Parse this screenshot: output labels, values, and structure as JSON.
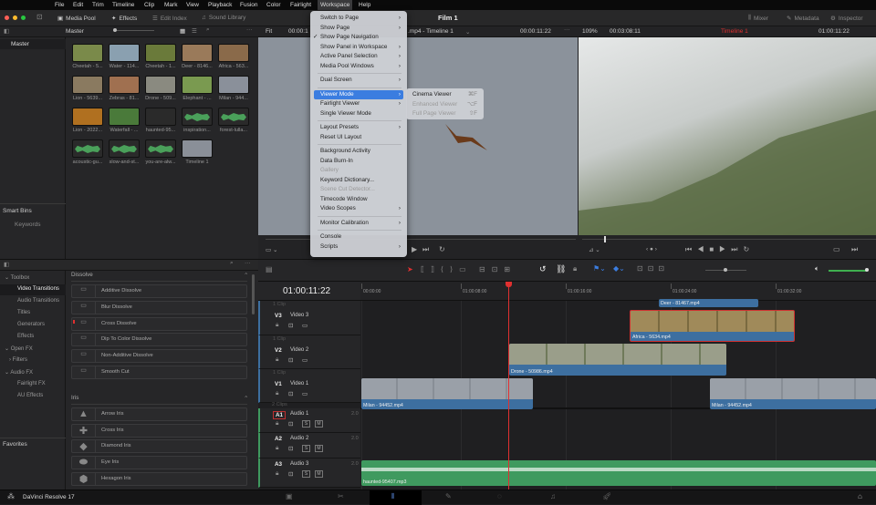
{
  "menubar": {
    "items": [
      "File",
      "Edit",
      "Trim",
      "Timeline",
      "Clip",
      "Mark",
      "View",
      "Playback",
      "Fusion",
      "Color",
      "Fairlight",
      "Workspace",
      "Help"
    ],
    "active": "Workspace"
  },
  "toolbar": {
    "media_pool": "Media Pool",
    "effects": "Effects",
    "edit_index": "Edit Index",
    "sound_library": "Sound Library",
    "project_title": "Film 1",
    "mixer": "Mixer",
    "metadata": "Metadata",
    "inspector": "Inspector"
  },
  "media_pool": {
    "bin_title": "Master",
    "bins": [
      "Master"
    ],
    "smart_bins_label": "Smart Bins",
    "smart_bins": [
      "Keywords"
    ],
    "clips": [
      {
        "name": "Cheetah - 5...",
        "color": "#7a8a4a"
      },
      {
        "name": "Water - 114...",
        "color": "#8aa0b0"
      },
      {
        "name": "Cheetah - 1...",
        "color": "#6a7a3a"
      },
      {
        "name": "Deer - 8146...",
        "color": "#9a7a5a"
      },
      {
        "name": "Africa - 563...",
        "color": "#8a6a4a"
      },
      {
        "name": "Lion - 5639...",
        "color": "#8a7a60"
      },
      {
        "name": "Zebras - 81...",
        "color": "#a07050"
      },
      {
        "name": "Drone - 509...",
        "color": "#8a8a80"
      },
      {
        "name": "Elephant - ...",
        "color": "#7a9a50"
      },
      {
        "name": "Milan - 944...",
        "color": "#8a909a"
      },
      {
        "name": "Lion - 2022...",
        "color": "#b07020"
      },
      {
        "name": "Waterfall - ...",
        "color": "#4a7a3a"
      },
      {
        "name": "haunted-95...",
        "color": "#2a2a2a"
      },
      {
        "name": "inspiration...",
        "color": "#3a3a3a",
        "audio": true
      },
      {
        "name": "forest-lulla...",
        "color": "#3a3a3a",
        "audio": true
      },
      {
        "name": "acoustic-gu...",
        "color": "#2a2a2a",
        "audio": true
      },
      {
        "name": "slow-and-st...",
        "color": "#5a5030",
        "audio": true
      },
      {
        "name": "you-are-alw...",
        "color": "#3a3a3a",
        "audio": true
      },
      {
        "name": "Timeline 1",
        "color": "#8a8f98"
      }
    ]
  },
  "source_viewer": {
    "zoom": "Fit",
    "timecode": "00:00:1",
    "clip_title": ".mp4 - Timeline 1",
    "timecode_right": "00:00:11:22"
  },
  "timeline_viewer": {
    "zoom": "109%",
    "duration": "00:03:08:11",
    "timeline_name": "Timeline 1",
    "timecode": "01:00:11:22"
  },
  "workspace_menu": {
    "items": [
      {
        "label": "Switch to Page",
        "sub": true
      },
      {
        "label": "Show Page",
        "sub": true
      },
      {
        "label": "Show Page Navigation",
        "checked": true
      },
      {
        "label": "Show Panel in Workspace",
        "sub": true
      },
      {
        "label": "Active Panel Selection",
        "sub": true
      },
      {
        "label": "Media Pool Windows",
        "sub": true
      },
      {
        "sep": true
      },
      {
        "label": "Dual Screen",
        "sub": true
      },
      {
        "sep": true
      },
      {
        "label": "Viewer Mode",
        "sub": true,
        "selected": true
      },
      {
        "label": "Fairlight Viewer",
        "sub": true
      },
      {
        "label": "Single Viewer Mode"
      },
      {
        "sep": true
      },
      {
        "label": "Layout Presets",
        "sub": true
      },
      {
        "label": "Reset UI Layout"
      },
      {
        "sep": true
      },
      {
        "label": "Background Activity"
      },
      {
        "label": "Data Burn-In"
      },
      {
        "label": "Gallery",
        "disabled": true
      },
      {
        "label": "Keyword Dictionary..."
      },
      {
        "label": "Scene Cut Detector...",
        "disabled": true
      },
      {
        "label": "Timecode Window"
      },
      {
        "label": "Video Scopes",
        "sub": true
      },
      {
        "sep": true
      },
      {
        "label": "Monitor Calibration",
        "sub": true
      },
      {
        "sep": true
      },
      {
        "label": "Console"
      },
      {
        "label": "Scripts",
        "sub": true
      }
    ],
    "viewer_mode_submenu": [
      {
        "label": "Cinema Viewer",
        "shortcut": "⌘F"
      },
      {
        "label": "Enhanced Viewer",
        "shortcut": "⌥F",
        "disabled": true
      },
      {
        "label": "Full Page Viewer",
        "shortcut": "⇧F",
        "disabled": true
      }
    ]
  },
  "effects": {
    "tree": [
      {
        "label": "Toolbox",
        "level": 0,
        "open": true
      },
      {
        "label": "Video Transitions",
        "level": 1,
        "selected": true
      },
      {
        "label": "Audio Transitions",
        "level": 1
      },
      {
        "label": "Titles",
        "level": 1
      },
      {
        "label": "Generators",
        "level": 1
      },
      {
        "label": "Effects",
        "level": 1
      },
      {
        "label": "Open FX",
        "level": 0,
        "open": true
      },
      {
        "label": "Filters",
        "level": 0.5
      },
      {
        "label": "Audio FX",
        "level": 0,
        "open": true
      },
      {
        "label": "Fairlight FX",
        "level": 1
      },
      {
        "label": "AU Effects",
        "level": 1
      }
    ],
    "favorites_label": "Favorites",
    "groups": [
      {
        "title": "Dissolve",
        "items": [
          "Additive Dissolve",
          "Blur Dissolve",
          "Cross Dissolve",
          "Dip To Color Dissolve",
          "Non-Additive Dissolve",
          "Smooth Cut"
        ]
      },
      {
        "title": "Iris",
        "items": [
          "Arrow Iris",
          "Cross Iris",
          "Diamond Iris",
          "Eye Iris",
          "Hexagon Iris"
        ]
      }
    ]
  },
  "timeline": {
    "timecode": "01:00:11:22",
    "ruler": [
      "00:00:00",
      "01:00:08:00",
      "01:00:16:00",
      "01:00:24:00",
      "01:00:32:00"
    ],
    "tracks": [
      {
        "id": "V3",
        "name": "Video 3",
        "clips_count": "1 Clip"
      },
      {
        "id": "V2",
        "name": "Video 2",
        "clips_count": "1 Clip"
      },
      {
        "id": "V1",
        "name": "Video 1",
        "clips_count": "1 Clip"
      },
      {
        "id": "A1",
        "name": "Audio 1",
        "level": "2.0",
        "clips_count": "2 Clips"
      },
      {
        "id": "A2",
        "name": "Audio 2",
        "level": "2.0"
      },
      {
        "id": "A3",
        "name": "Audio 3",
        "level": "2.0"
      }
    ],
    "clips": {
      "deer": "Deer - 81467.mp4",
      "africa": "Africa - 5634.mp4",
      "drone": "Drone - 50986.mp4",
      "milan1": "Milan - 94452.mp4",
      "milan2": "Milan - 94452.mp4",
      "haunted": "haunted-95407.mp3"
    },
    "playhead_color": "#e03030"
  },
  "app": {
    "name": "DaVinci Resolve 17"
  },
  "colors": {
    "accent": "#3b7de0",
    "video_clip": "#3d6fa0",
    "audio_clip": "#3f9a5f",
    "record": "#e03030"
  }
}
